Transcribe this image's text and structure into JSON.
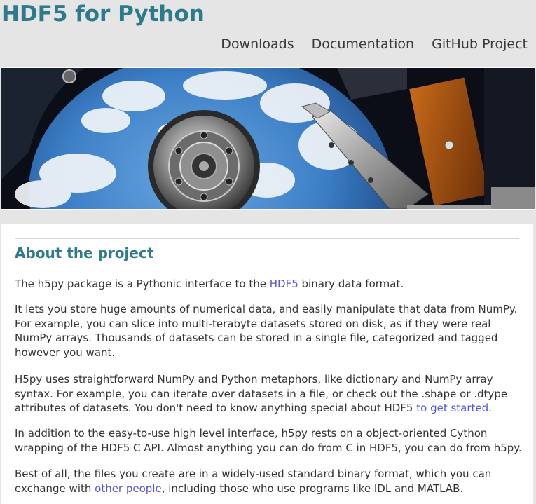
{
  "header": {
    "title": "HDF5 for Python",
    "nav": [
      "Downloads",
      "Documentation",
      "GitHub Project"
    ]
  },
  "banner": {
    "subject": "hard-drive-platter-image"
  },
  "about": {
    "heading": "About the project",
    "p1": {
      "before": "The h5py package is a Pythonic interface to the ",
      "link": "HDF5",
      "after": " binary data format."
    },
    "p2": "It lets you store huge amounts of numerical data, and easily manipulate that data from NumPy. For example, you can slice into multi-terabyte datasets stored on disk, as if they were real NumPy arrays. Thousands of datasets can be stored in a single file, categorized and tagged however you want.",
    "p3": {
      "before": "H5py uses straightforward NumPy and Python metaphors, like dictionary and NumPy array syntax. For example, you can iterate over datasets in a file, or check out the .shape or .dtype attributes of datasets. You don't need to know anything special about HDF5 ",
      "link": "to get started",
      "after": "."
    },
    "p4": "In addition to the easy-to-use high level interface, h5py rests on a object-oriented Cython wrapping of the HDF5 C API. Almost anything you can do from C in HDF5, you can do from h5py.",
    "p5": {
      "before": "Best of all, the files you create are in a widely-used standard binary format, which you can exchange with ",
      "link": "other people",
      "after": ", including those who use programs like IDL and MATLAB."
    }
  },
  "colors": {
    "title": "#2c7a8c",
    "link": "#5555dd",
    "page_bg": "#e5e5e5"
  }
}
